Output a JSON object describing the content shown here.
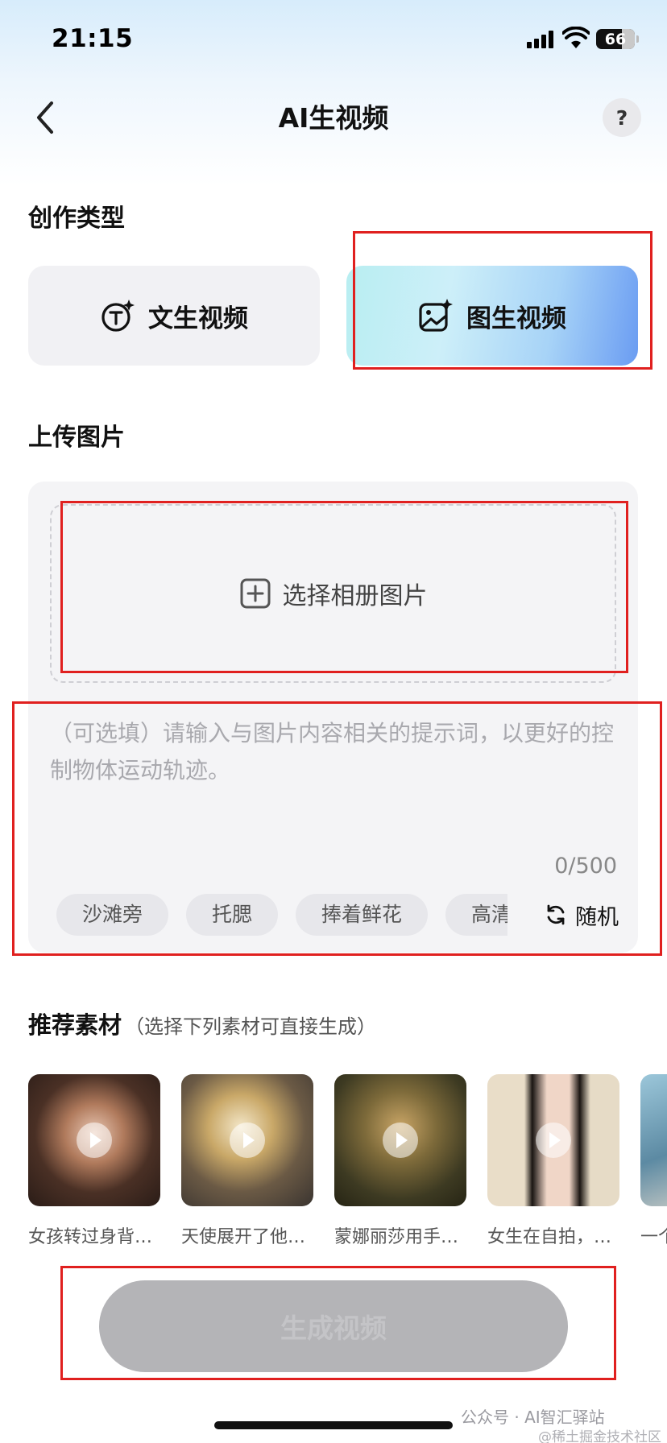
{
  "status_bar": {
    "time": "21:15",
    "battery": "66"
  },
  "nav": {
    "title": "AI生视频",
    "help": "?"
  },
  "creation_type": {
    "title": "创作类型",
    "options": [
      {
        "label": "文生视频",
        "icon": "text-sparkle-icon",
        "selected": false
      },
      {
        "label": "图生视频",
        "icon": "image-sparkle-icon",
        "selected": true
      }
    ]
  },
  "upload": {
    "title": "上传图片",
    "select_label": "选择相册图片",
    "prompt_placeholder": "（可选填）请输入与图片内容相关的提示词，以更好的控制物体运动轨迹。",
    "counter": "0/500",
    "chips": [
      "沙滩旁",
      "托腮",
      "捧着鲜花",
      "高清"
    ],
    "random_label": "随机"
  },
  "recommended": {
    "title": "推荐素材",
    "subtitle": "（选择下列素材可直接生成）",
    "items": [
      {
        "caption": "女孩转过身背…"
      },
      {
        "caption": "天使展开了他…"
      },
      {
        "caption": "蒙娜丽莎用手…"
      },
      {
        "caption": "女生在自拍，…"
      },
      {
        "caption": "一个"
      }
    ]
  },
  "generate_button": "生成视频",
  "watermark": {
    "main": "公众号 · AI智汇驿站",
    "sub": "@稀土掘金技术社区"
  },
  "colors": {
    "highlight_box": "#e0201f",
    "selected_gradient_end": "#6a9cf2",
    "disabled_button": "#b4b4b7"
  }
}
